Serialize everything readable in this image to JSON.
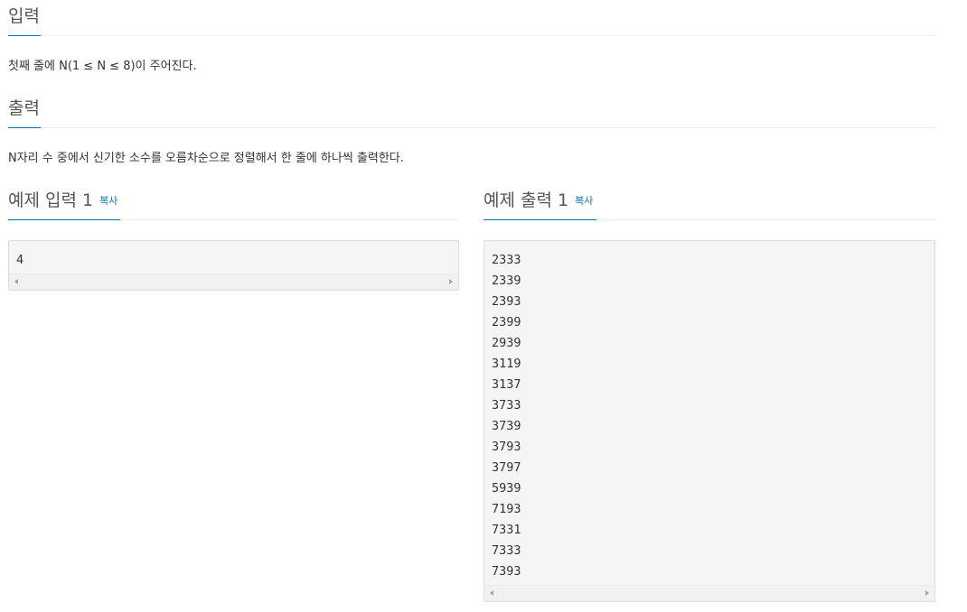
{
  "input_section": {
    "title": "입력",
    "description": "첫째 줄에 N(1 ≤ N ≤ 8)이 주어진다."
  },
  "output_section": {
    "title": "출력",
    "description": "N자리 수 중에서 신기한 소수를 오름차순으로 정렬해서 한 줄에 하나씩 출력한다."
  },
  "sample_input": {
    "title": "예제 입력",
    "number": "1",
    "copy_label": "복사",
    "lines": [
      "4"
    ]
  },
  "sample_output": {
    "title": "예제 출력",
    "number": "1",
    "copy_label": "복사",
    "lines": [
      "2333",
      "2339",
      "2393",
      "2399",
      "2939",
      "3119",
      "3137",
      "3733",
      "3739",
      "3793",
      "3797",
      "5939",
      "7193",
      "7331",
      "7333",
      "7393"
    ]
  },
  "colors": {
    "accent": "#0076c0",
    "code_background": "#f5f5f5"
  }
}
